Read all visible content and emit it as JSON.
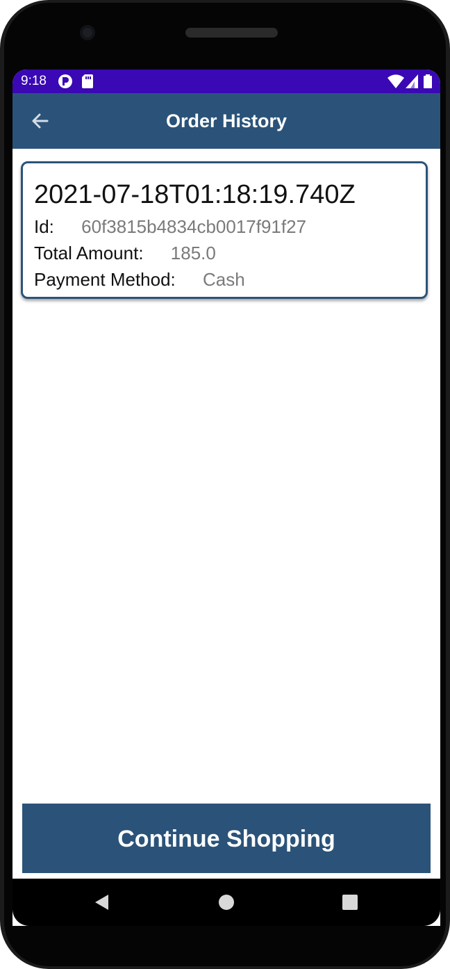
{
  "status_bar": {
    "time": "9:18",
    "background_color": "#3a08b4",
    "icons": [
      "p-notification-icon",
      "sd-card-icon",
      "wifi-icon",
      "signal-icon",
      "battery-icon"
    ]
  },
  "app_bar": {
    "title": "Order History",
    "background_color": "#2b5379",
    "back_icon": "arrow-left-icon"
  },
  "orders": [
    {
      "date": "2021-07-18T01:18:19.740Z",
      "id_label": "Id:",
      "id_value": "60f3815b4834cb0017f91f27",
      "total_label": "Total Amount:",
      "total_value": "185.0",
      "payment_label": "Payment Method:",
      "payment_value": "Cash"
    }
  ],
  "continue_button": {
    "label": "Continue Shopping"
  },
  "nav_bar": {
    "icons": [
      "back-triangle-icon",
      "home-circle-icon",
      "recents-square-icon"
    ]
  }
}
